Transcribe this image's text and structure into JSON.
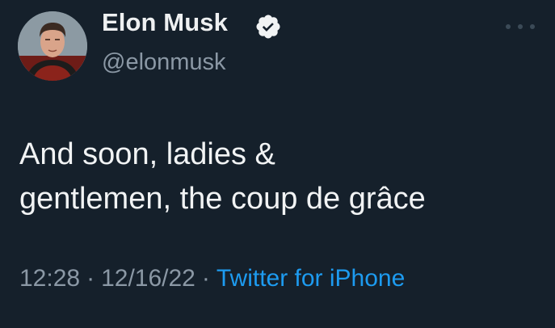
{
  "author": {
    "display_name": "Elon Musk",
    "handle": "@elonmusk",
    "verified": true
  },
  "tweet": {
    "text_lines": [
      "And soon, ladies &",
      "gentlemen, the coup de grâce"
    ],
    "time": "12:28",
    "date": "12/16/22",
    "separator": "·",
    "source": "Twitter for iPhone"
  },
  "colors": {
    "background": "#15202b",
    "text": "#e7e9ea",
    "secondary": "#8b98a5",
    "accent": "#1d9bf0"
  },
  "icons": {
    "verified": "verified-badge-icon",
    "more": "more-horizontal-icon"
  }
}
